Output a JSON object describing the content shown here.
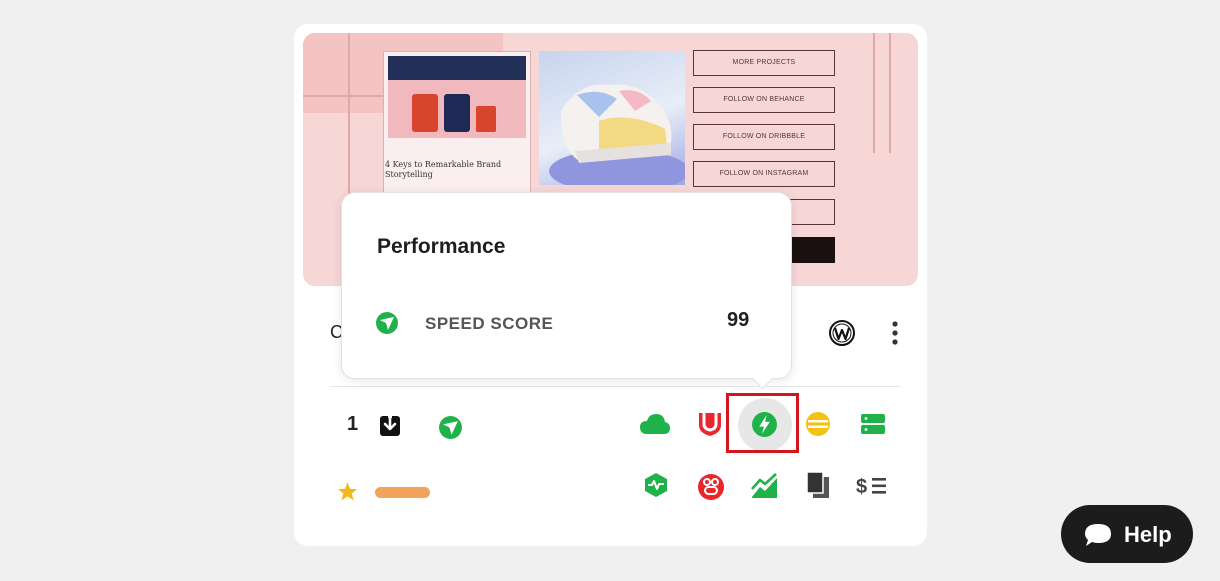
{
  "preview": {
    "blog_title": "4 Keys to Remarkable Brand Storytelling",
    "buttons": [
      "MORE PROJECTS",
      "FOLLOW ON BEHANCE",
      "FOLLOW ON DRIBBBLE",
      "FOLLOW ON INSTAGRAM"
    ]
  },
  "popover": {
    "title": "Performance",
    "metric_label": "SPEED SCORE",
    "metric_value": "99",
    "metric_icon": "speed-score-icon"
  },
  "site": {
    "title_partial": "C",
    "platform_icon": "wordpress-icon",
    "menu_icon": "kebab-menu-icon"
  },
  "stats": {
    "count": "1",
    "rating_icon": "star-icon"
  },
  "tools_row1": [
    "cloud-icon",
    "shield-icon",
    "performance-icon",
    "coin-stack-icon",
    "server-icon"
  ],
  "tools_row2": [
    "uptime-monitor-icon",
    "link-checker-icon",
    "analytics-chart-icon",
    "documents-icon",
    "pricing-icon"
  ],
  "help": {
    "label": "Help"
  },
  "colors": {
    "accent_green": "#1fb24a",
    "highlight_red": "#d2161c",
    "rating_orange": "#f2a45a"
  }
}
